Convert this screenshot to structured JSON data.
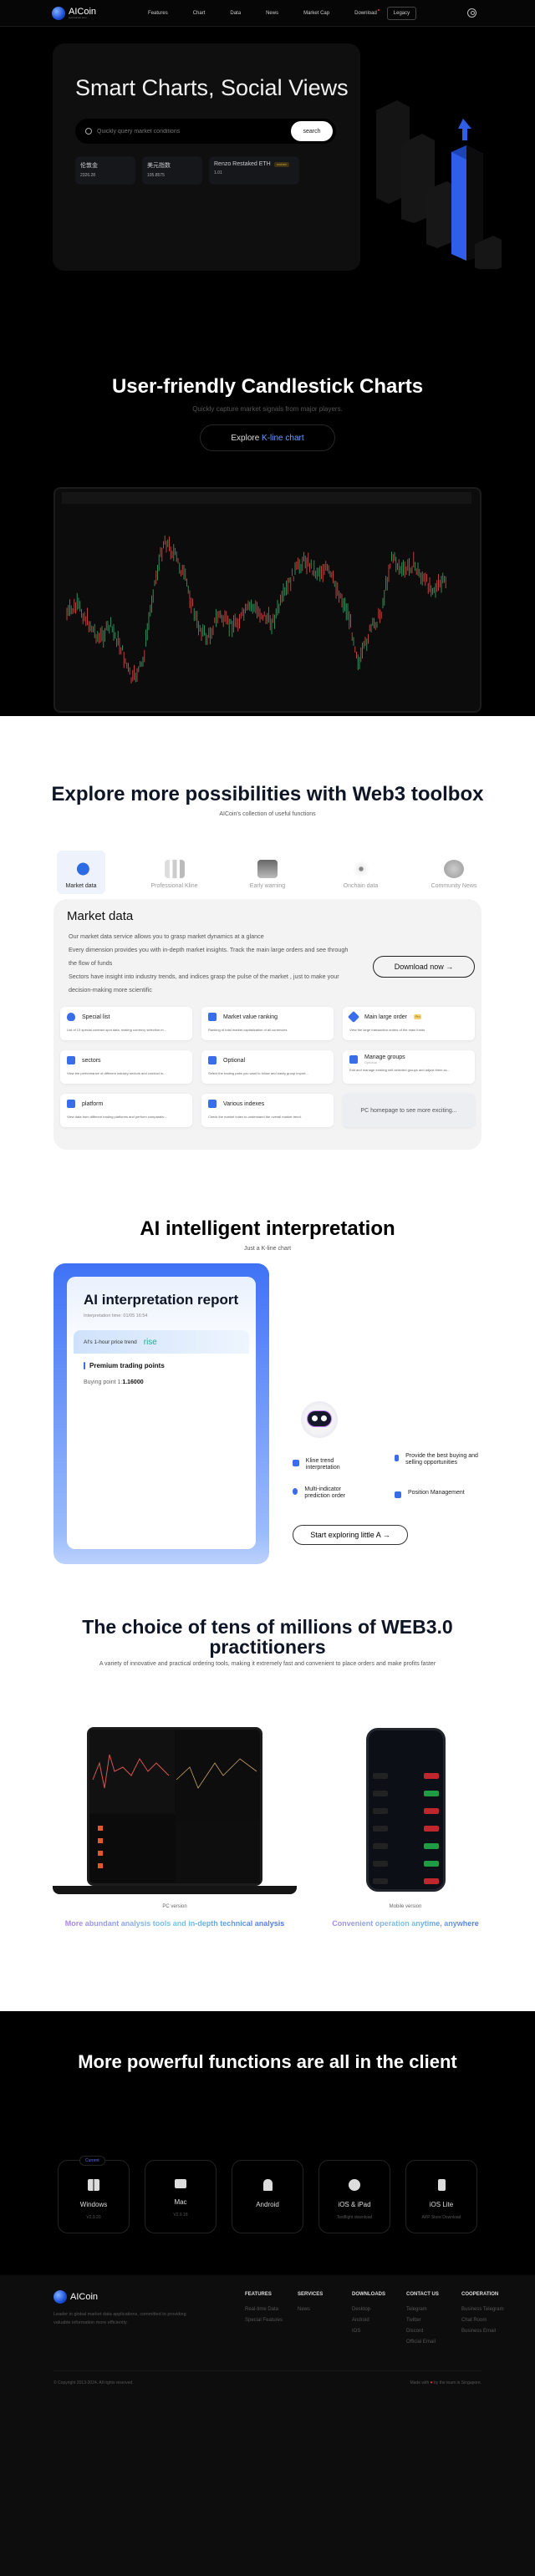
{
  "nav": {
    "brand": "AICoin",
    "brand_sub": "www.aicoin.com",
    "links": [
      "Features",
      "Chart",
      "Data",
      "News",
      "Market Cap",
      "Download"
    ],
    "legacy": "Legacy"
  },
  "hero": {
    "title": "Smart Charts, Social Views",
    "search_placeholder": "Quickly query market conditions",
    "search_button": "search",
    "tickers": [
      {
        "name": "伦敦金",
        "value": "2326.28"
      },
      {
        "name": "美元指数",
        "value": "105.8575"
      },
      {
        "name": "Renzo Restaked ETH",
        "value": "1.01",
        "badge": "onchain"
      }
    ]
  },
  "candles": {
    "title": "User-friendly Candlestick Charts",
    "subtitle": "Quickly capture market signals from major players.",
    "button_prefix": "Explore ",
    "button_highlight": "K-line chart"
  },
  "toolbox": {
    "title": "Explore more possibilities with Web3 toolbox",
    "subtitle": "AICoin's collection of useful functions",
    "tabs": [
      "Market data",
      "Professional Kline",
      "Early warning",
      "Onchain data",
      "Community News"
    ],
    "active_tab": "Market data",
    "panel": {
      "title": "Market data",
      "desc": [
        "Our market data service allows you to grasp market dynamics at a glance",
        "Every dimension provides you with in-depth market insights. Track the main large orders and see through the flow of funds",
        "Sectors have insight into industry trends, and indices grasp the pulse of the market , just to make your decision-making more scientific"
      ],
      "download": "Download now →",
      "cards": [
        {
          "title": "Special list",
          "desc": "List of 13 special contract spot data, making currency selection m..."
        },
        {
          "title": "Market value ranking",
          "desc": "Ranking of total market capitalization of all currencies"
        },
        {
          "title": "Main large order",
          "badge": "Pro",
          "desc": "View the large transaction orders of the main funds"
        },
        {
          "title": "sectors",
          "desc": "View the performance of different industry sectors and conduct in..."
        },
        {
          "title": "Optional",
          "desc": "Select the trading pairs you want to follow and easily group import..."
        },
        {
          "title": "Manage groups",
          "sub": "Optional",
          "desc": "Edit and manage existing self-selected groups and adjust them ac..."
        },
        {
          "title": "platform",
          "desc": "View data from different trading platforms and perform comparativ..."
        },
        {
          "title": "Various indexes",
          "desc": "Check the market index to understand the overall market trend."
        }
      ],
      "more": "PC homepage to see more exciting..."
    }
  },
  "ai": {
    "title": "AI intelligent interpretation",
    "subtitle": "Just a K-line chart",
    "report_title": "AI interpretation report",
    "report_time": "Interpretation time: 01/05 16:54",
    "trend_label": "AI's 1-hour price trend",
    "trend_value": "rise",
    "premium": "Premium trading points",
    "buy_label": "Buying point 1:",
    "buy_value": "1.16000",
    "features": [
      "Kline trend interpretation",
      "Provide the best buying and selling opportunities",
      "Multi-indicator prediction order",
      "Position Management"
    ],
    "button": "Start exploring little A →"
  },
  "choice": {
    "title": "The choice of tens of millions of WEB3.0 practitioners",
    "subtitle": "A variety of innovative and practical ordering tools, making it extremely fast and convenient to place orders and make profits faster",
    "pc_caption": "PC version",
    "mobile_caption": "Mobile version",
    "pc_tagline": "More abundant analysis tools and in-depth technical analysis",
    "mobile_tagline": "Convenient operation anytime, anywhere"
  },
  "client": {
    "title": "More powerful functions are all in the client",
    "current": "Current",
    "platforms": [
      {
        "name": "Windows",
        "sub": "V2.9.20"
      },
      {
        "name": "Mac",
        "sub": "V2.9.18"
      },
      {
        "name": "Android",
        "sub": ""
      },
      {
        "name": "iOS & iPad",
        "sub": "Testflight download"
      },
      {
        "name": "iOS Lite",
        "sub": "APP Store Download"
      }
    ]
  },
  "footer": {
    "brand": "AICoin",
    "desc": "Leader in global market data applications, committed to providing valuable information more efficiently.",
    "columns": [
      {
        "title": "FEATURES",
        "links": [
          "Real-time Data",
          "Special Features"
        ]
      },
      {
        "title": "SERVICES",
        "links": [
          "News"
        ]
      },
      {
        "title": "DOWNLOADS",
        "links": [
          "Desktop",
          "Android",
          "IOS"
        ]
      },
      {
        "title": "CONTACT US",
        "links": [
          "Telegram",
          "Twitter",
          "Discord",
          "Official Email"
        ]
      },
      {
        "title": "COOPERATION",
        "links": [
          "Business Telegram",
          "Chat Room",
          "Business Email"
        ]
      }
    ],
    "copyright": "© Copyright 2013-2024. All rights reserved.",
    "made_prefix": "Made with",
    "made_suffix": "by the team in Singapore."
  }
}
